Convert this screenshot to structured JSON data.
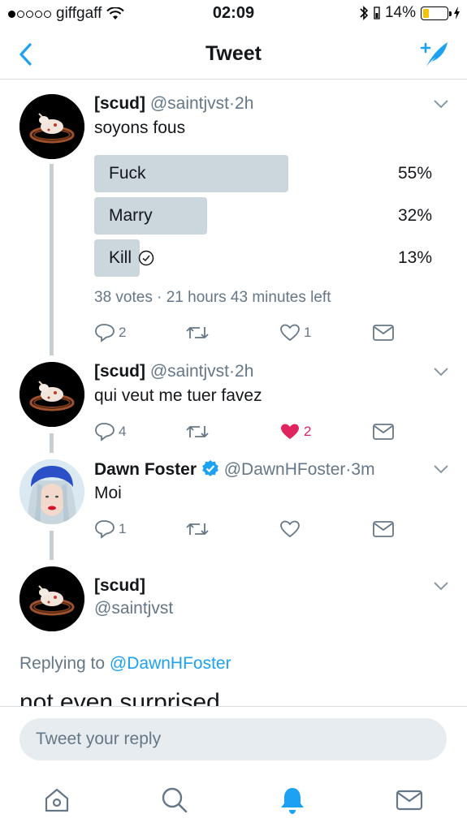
{
  "status_bar": {
    "carrier": "giffgaff",
    "time": "02:09",
    "battery": "14%"
  },
  "nav": {
    "title": "Tweet"
  },
  "tweets": [
    {
      "name": "[scud]",
      "handle": "@saintjvst",
      "separator": "·",
      "time": "2h",
      "text": "soyons fous",
      "poll": {
        "options": [
          {
            "label": "Fuck",
            "percent_text": "55%",
            "percent": 55
          },
          {
            "label": "Marry",
            "percent_text": "32%",
            "percent": 32
          },
          {
            "label": "Kill",
            "percent_text": "13%",
            "percent": 13,
            "chosen": true
          }
        ],
        "meta": "38 votes · 21 hours 43 minutes left"
      },
      "actions": {
        "replies": "2",
        "retweets": "",
        "likes": "1",
        "liked": false
      }
    },
    {
      "name": "[scud]",
      "handle": "@saintjvst",
      "separator": "·",
      "time": "2h",
      "text": "qui veut me tuer favez",
      "actions": {
        "replies": "4",
        "retweets": "",
        "likes": "2",
        "liked": true
      }
    },
    {
      "name": "Dawn Foster",
      "verified": true,
      "handle": "@DawnHFoster",
      "separator": "·",
      "time": "3m",
      "text": "Moi",
      "actions": {
        "replies": "1",
        "retweets": "",
        "likes": "",
        "liked": false
      }
    },
    {
      "name": "[scud]",
      "handle": "@saintjvst"
    }
  ],
  "reply_context": {
    "prefix": "Replying to",
    "target": "@DawnHFoster",
    "text": "not even surprised"
  },
  "reply_bar": {
    "placeholder": "Tweet your reply"
  },
  "tab_bar": {
    "items": [
      "home-icon",
      "search-icon",
      "notifications-icon",
      "messages-icon"
    ],
    "active": "notifications-icon"
  },
  "colors": {
    "accent": "#1da1f2",
    "like": "#e0245e",
    "poll_bar": "#ccd6dd",
    "muted": "#657786"
  }
}
